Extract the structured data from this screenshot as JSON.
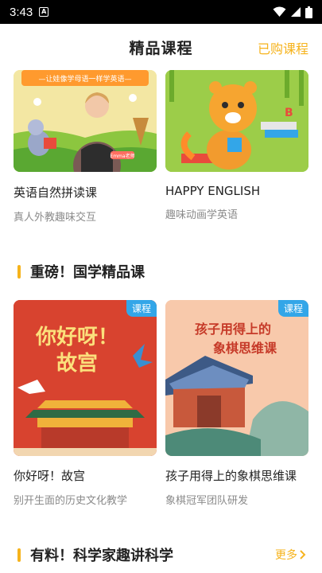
{
  "status_bar": {
    "time": "3:43",
    "notification_icon": "A"
  },
  "header": {
    "title": "精品课程",
    "purchased_link": "已购课程"
  },
  "top_courses": [
    {
      "title": "英语自然拼读课",
      "subtitle": "真人外教趣味交互",
      "banner_text": "—让娃像学母语一样学英语—",
      "teacher_tag": "Emma老师"
    },
    {
      "title": "HAPPY ENGLISH",
      "subtitle": "趣味动画学英语"
    }
  ],
  "section_guoxue": {
    "title": "重磅！国学精品课",
    "courses": [
      {
        "title": "你好呀！故宫",
        "subtitle": "别开生面的历史文化教学",
        "tag": "课程",
        "poster_line1": "你好呀！",
        "poster_line2": "故宫"
      },
      {
        "title": "孩子用得上的象棋思维课",
        "subtitle": "象棋冠军团队研发",
        "tag": "课程",
        "poster_line1": "孩子用得上的",
        "poster_line2": "象棋思维课"
      }
    ]
  },
  "section_science": {
    "title": "有料！科学家趣讲科学",
    "more": "更多"
  },
  "colors": {
    "accent": "#f6b31c",
    "tag_blue": "#33a6e8",
    "text": "#222222",
    "muted": "#8a8a8a"
  },
  "icons": [
    "wifi-icon",
    "signal-icon",
    "battery-icon",
    "chevron-right-icon"
  ]
}
